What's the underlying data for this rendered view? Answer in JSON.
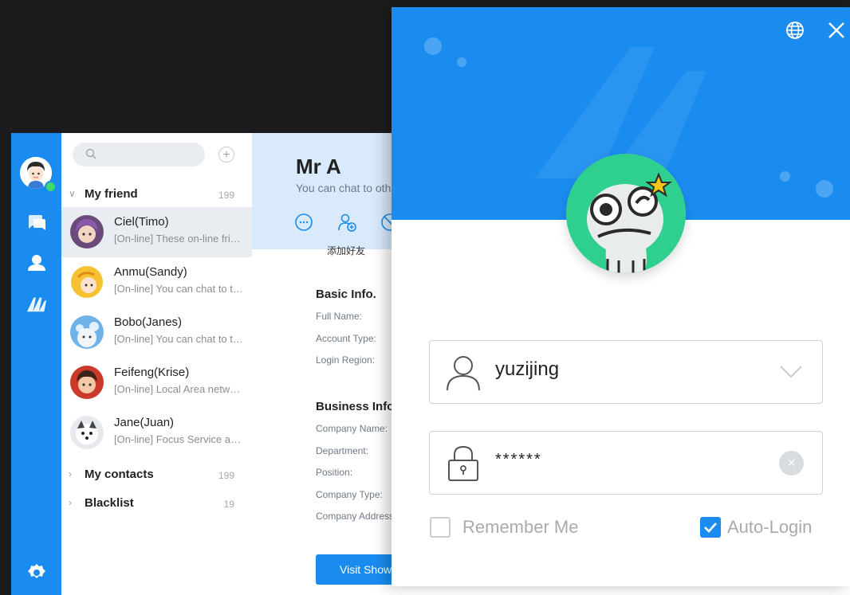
{
  "colors": {
    "accent": "#1a8cf0",
    "online": "#3ddc62",
    "avatar_bg": "#2fd08f"
  },
  "app": {
    "rail": {
      "icons": [
        "user-avatar",
        "chat-icon",
        "contacts-icon",
        "brand-logo-icon",
        "settings-icon"
      ]
    },
    "friends": {
      "groups": [
        {
          "name": "My friend",
          "count": "199",
          "expanded": true
        },
        {
          "name": "My contacts",
          "count": "199",
          "expanded": false
        },
        {
          "name": "Blacklist",
          "count": "19",
          "expanded": false
        }
      ],
      "contacts": [
        {
          "name": "Ciel(Timo)",
          "status": "[On-line] These on-line friends are listed here",
          "selected": true
        },
        {
          "name": "Anmu(Sandy)",
          "status": "[On-line] You can chat to them directly"
        },
        {
          "name": "Bobo(Janes)",
          "status": "[On-line] You can chat to them directly"
        },
        {
          "name": "Feifeng(Krise)",
          "status": "[On-line] Local Area network account"
        },
        {
          "name": "Jane(Juan)",
          "status": "[On-line] Focus Service account"
        }
      ]
    },
    "detail": {
      "name": "Mr A",
      "subtitle": "You can chat to other users",
      "action_label": "添加好友",
      "basic_title": "Basic Info.",
      "basic_fields": [
        "Full Name:",
        "Account Type:",
        "Login Region:"
      ],
      "business_title": "Business Info.",
      "business_fields": [
        "Company Name:",
        "Department:",
        "Position:",
        "Company Type:",
        "Company Address:"
      ],
      "visit_button": "Visit Show"
    }
  },
  "login": {
    "username": "yuzijing",
    "password_mask": "******",
    "remember_label": "Remember Me",
    "remember_checked": false,
    "autologin_label": "Auto-Login",
    "autologin_checked": true
  }
}
